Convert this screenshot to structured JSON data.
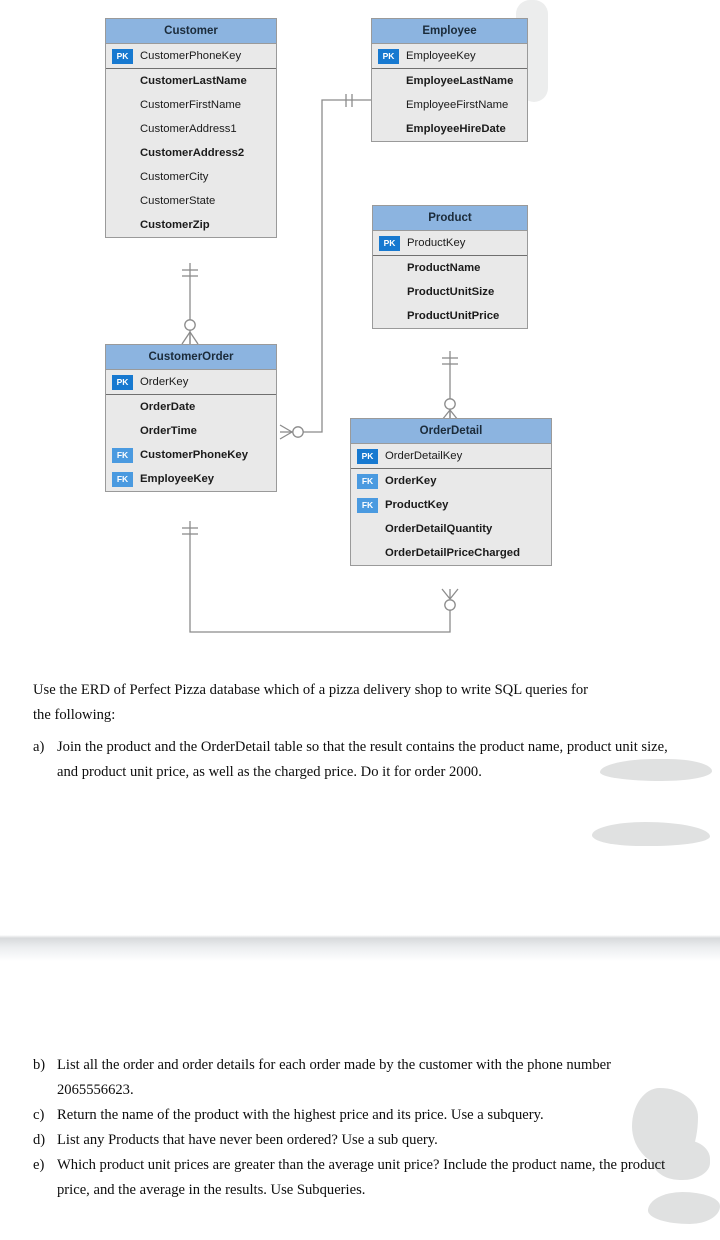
{
  "document": {
    "type": "erd-exercise-worksheet"
  },
  "erd": {
    "title": "Perfect Pizza ERD",
    "colors": {
      "entity_header": "#8cb4e0",
      "entity_body": "#e9e9e9",
      "entity_border": "#9a9a9a",
      "pk_badge": "#1779d0",
      "fk_badge": "#4a9ae0",
      "connector": "#8b8b8b"
    },
    "entities": [
      {
        "name": "Customer",
        "keys": [
          {
            "badge": "PK",
            "name": "CustomerPhoneKey",
            "bold": false
          }
        ],
        "attributes": [
          {
            "badge": "",
            "name": "CustomerLastName",
            "bold": true
          },
          {
            "badge": "",
            "name": "CustomerFirstName",
            "bold": false
          },
          {
            "badge": "",
            "name": "CustomerAddress1",
            "bold": false
          },
          {
            "badge": "",
            "name": "CustomerAddress2",
            "bold": true
          },
          {
            "badge": "",
            "name": "CustomerCity",
            "bold": false
          },
          {
            "badge": "",
            "name": "CustomerState",
            "bold": false
          },
          {
            "badge": "",
            "name": "CustomerZip",
            "bold": true
          }
        ]
      },
      {
        "name": "Employee",
        "keys": [
          {
            "badge": "PK",
            "name": "EmployeeKey",
            "bold": false
          }
        ],
        "attributes": [
          {
            "badge": "",
            "name": "EmployeeLastName",
            "bold": true
          },
          {
            "badge": "",
            "name": "EmployeeFirstName",
            "bold": false
          },
          {
            "badge": "",
            "name": "EmployeeHireDate",
            "bold": true
          }
        ]
      },
      {
        "name": "Product",
        "keys": [
          {
            "badge": "PK",
            "name": "ProductKey",
            "bold": false
          }
        ],
        "attributes": [
          {
            "badge": "",
            "name": "ProductName",
            "bold": true
          },
          {
            "badge": "",
            "name": "ProductUnitSize",
            "bold": true
          },
          {
            "badge": "",
            "name": "ProductUnitPrice",
            "bold": true
          }
        ]
      },
      {
        "name": "CustomerOrder",
        "keys": [
          {
            "badge": "PK",
            "name": "OrderKey",
            "bold": false
          }
        ],
        "attributes": [
          {
            "badge": "",
            "name": "OrderDate",
            "bold": true
          },
          {
            "badge": "",
            "name": "OrderTime",
            "bold": true
          },
          {
            "badge": "FK",
            "name": "CustomerPhoneKey",
            "bold": true
          },
          {
            "badge": "FK",
            "name": "EmployeeKey",
            "bold": true
          }
        ]
      },
      {
        "name": "OrderDetail",
        "keys": [
          {
            "badge": "PK",
            "name": "OrderDetailKey",
            "bold": false
          }
        ],
        "attributes": [
          {
            "badge": "FK",
            "name": "OrderKey",
            "bold": true
          },
          {
            "badge": "FK",
            "name": "ProductKey",
            "bold": true
          },
          {
            "badge": "",
            "name": "OrderDetailQuantity",
            "bold": true
          },
          {
            "badge": "",
            "name": "OrderDetailPriceCharged",
            "bold": true
          }
        ]
      }
    ],
    "relationships": [
      {
        "from": "Customer",
        "to": "CustomerOrder",
        "from_cardinality": "one-and-only-one",
        "to_cardinality": "zero-or-many"
      },
      {
        "from": "Employee",
        "to": "CustomerOrder",
        "from_cardinality": "one-and-only-one",
        "to_cardinality": "zero-or-many"
      },
      {
        "from": "Product",
        "to": "OrderDetail",
        "from_cardinality": "one-and-only-one",
        "to_cardinality": "zero-or-many"
      },
      {
        "from": "CustomerOrder",
        "to": "OrderDetail",
        "from_cardinality": "one-and-only-one",
        "to_cardinality": "zero-or-many"
      }
    ]
  },
  "intro": {
    "line1": "Use the ERD of Perfect Pizza  database which of a pizza delivery shop to write SQL queries for",
    "line2": "the following:"
  },
  "questions": [
    {
      "label": "a)",
      "text": "Join the product and the OrderDetail table so that the result contains the product name, product unit size, and product unit price, as well as the charged price. Do it for order 2000."
    },
    {
      "label": "b)",
      "text": "List all the order and order details for each order made by the customer with the phone number 2065556623."
    },
    {
      "label": "c)",
      "text": "Return the name of the product with the highest price and its price. Use a subquery."
    },
    {
      "label": "d)",
      "text": "List any Products that have never been ordered? Use a sub query."
    },
    {
      "label": "e)",
      "text": "Which product unit prices are greater than the average unit price? Include the product name, the product price, and the average in the results. Use Subqueries."
    }
  ]
}
